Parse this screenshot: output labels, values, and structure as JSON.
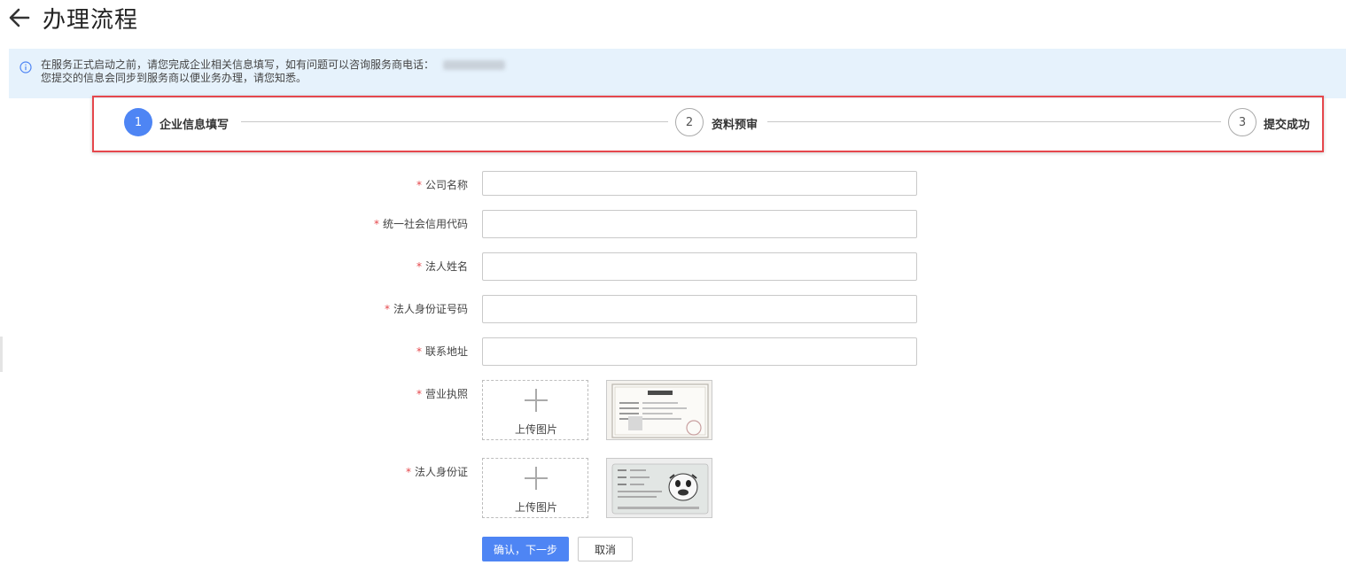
{
  "header": {
    "title": "办理流程",
    "back_icon": "arrow-left-icon"
  },
  "notice": {
    "icon": "info-icon",
    "line1": "在服务正式启动之前，请您完成企业相关信息填写，如有问题可以咨询服务商电话：",
    "line2": "您提交的信息会同步到服务商以便业务办理，请您知悉。"
  },
  "steps": [
    {
      "number": "1",
      "label": "企业信息填写",
      "state": "active"
    },
    {
      "number": "2",
      "label": "资料预审",
      "state": "pending"
    },
    {
      "number": "3",
      "label": "提交成功",
      "state": "pending"
    }
  ],
  "form": {
    "required_mark": "*",
    "fields": [
      {
        "label": "公司名称",
        "value": ""
      },
      {
        "label": "统一社会信用代码",
        "value": ""
      },
      {
        "label": "法人姓名",
        "value": ""
      },
      {
        "label": "法人身份证号码",
        "value": ""
      },
      {
        "label": "联系地址",
        "value": ""
      }
    ],
    "uploads": [
      {
        "label": "营业执照",
        "button_text": "上传图片",
        "preview": "business-license-image"
      },
      {
        "label": "法人身份证",
        "button_text": "上传图片",
        "preview": "id-card-image"
      }
    ]
  },
  "actions": {
    "confirm_label": "确认，下一步",
    "cancel_label": "取消"
  },
  "colors": {
    "primary": "#4e85f4",
    "highlight_border": "#e5474c",
    "notice_bg": "#e6f2fc",
    "required": "#e5474c"
  }
}
